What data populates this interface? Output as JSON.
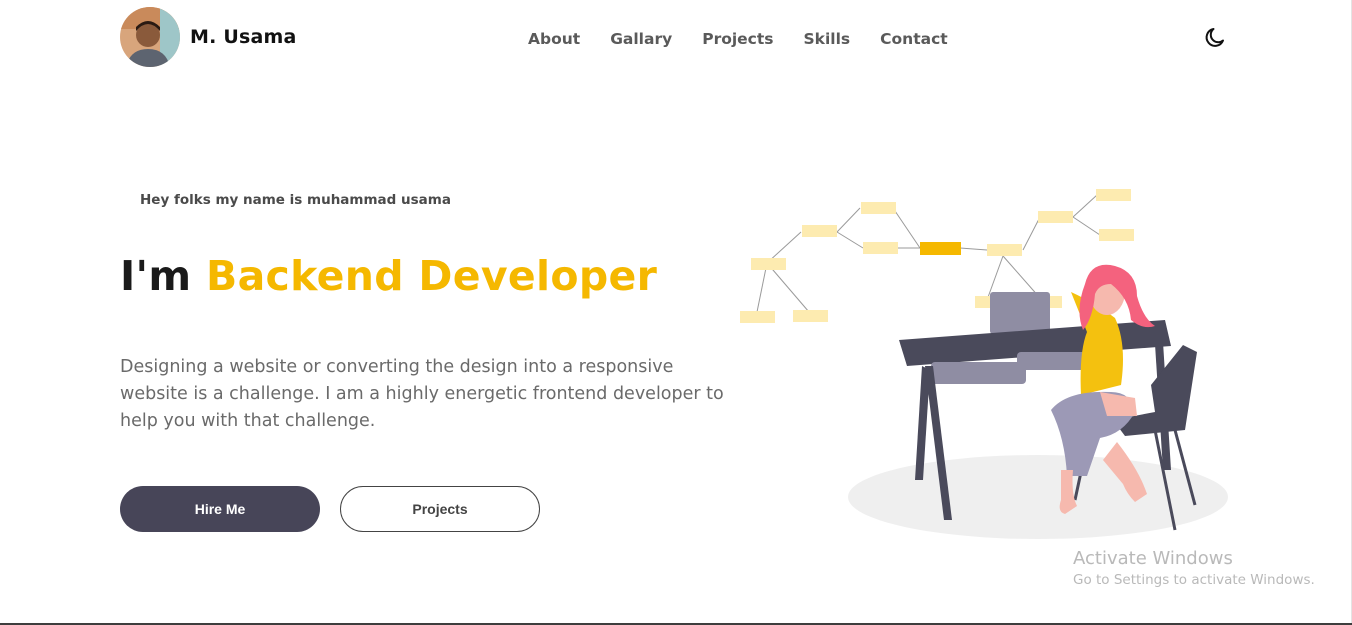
{
  "header": {
    "brand_name": "M. Usama",
    "avatar_alt": "profile photo"
  },
  "nav": {
    "items": [
      {
        "label": "About"
      },
      {
        "label": "Gallary"
      },
      {
        "label": "Projects"
      },
      {
        "label": "Skills"
      },
      {
        "label": "Contact"
      }
    ],
    "theme_toggle_icon": "moon-icon"
  },
  "hero": {
    "intro": "Hey folks my name is muhammad usama",
    "headline_prefix": "I'm",
    "headline_accent": "Backend Developer",
    "description": "Designing a website or converting the design into a responsive website is a challenge. I am a highly energetic frontend developer to help you with that challenge.",
    "primary_button": "Hire Me",
    "secondary_button": "Projects"
  },
  "colors": {
    "accent": "#f5b800",
    "primary_button_bg": "#474558",
    "text_dark": "#1a1a1a",
    "text_muted": "#6a6a6a"
  },
  "watermark": {
    "title": "Activate Windows",
    "subtitle": "Go to Settings to activate Windows."
  }
}
